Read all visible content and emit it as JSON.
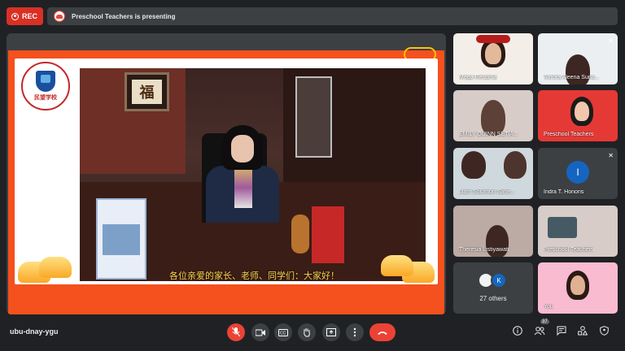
{
  "top_bar": {
    "rec_label": "REC",
    "presenting_text": "Preschool Teachers is presenting"
  },
  "slide": {
    "caption": "各位亲爱的家长、老师、同学们：大家好！",
    "logo_text": "民望学校",
    "scroll_char": "福"
  },
  "participants": [
    {
      "name": "Mega Resqinia",
      "muted": false
    },
    {
      "name": "Aurora Aleena Suna...",
      "muted": true
    },
    {
      "name": "EMILY QUINN SETIA...",
      "muted": false
    },
    {
      "name": "Preschool Teachers",
      "muted": false
    },
    {
      "name": "Liam Solomon Sahe...",
      "muted": false
    },
    {
      "name": "Indra T. Honoris",
      "muted": true,
      "avatar_letter": "I"
    },
    {
      "name": "Theresia Listiyawati",
      "muted": false
    },
    {
      "name": "Preschool Teachers",
      "muted": false
    },
    {
      "name": "27 others",
      "avatar_letter": "K"
    },
    {
      "name": "You",
      "muted": false
    }
  ],
  "bottom_bar": {
    "meeting_code": "ubu-dnay-ygu",
    "people_count": "37"
  },
  "icons": {
    "mic_off": "mic-off-icon",
    "camera": "camera-icon",
    "captions": "captions-icon",
    "raise_hand": "hand-icon",
    "present": "present-icon",
    "more": "more-vert-icon",
    "hangup": "hangup-icon",
    "info": "info-icon",
    "people": "people-icon",
    "chat": "chat-icon",
    "activities": "activities-icon",
    "host_controls": "shield-icon"
  },
  "colors": {
    "background": "#202124",
    "surface": "#3c4043",
    "danger": "#ea4335",
    "slide_bg": "#f4511e"
  }
}
